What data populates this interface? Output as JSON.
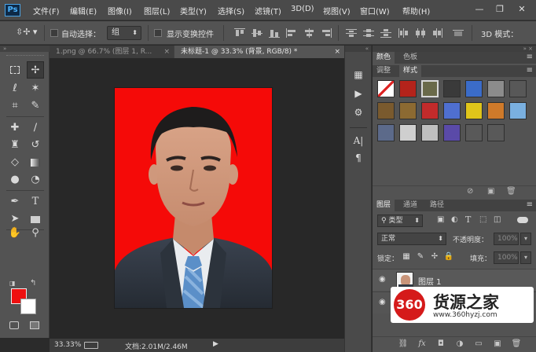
{
  "app": {
    "logo_text": "Ps"
  },
  "menu": [
    "文件(F)",
    "编辑(E)",
    "图像(I)",
    "图层(L)",
    "类型(Y)",
    "选择(S)",
    "滤镜(T)",
    "3D(D)",
    "视图(V)",
    "窗口(W)",
    "帮助(H)"
  ],
  "window_controls": {
    "minimize": "—",
    "restore": "❐",
    "close": "✕"
  },
  "options": {
    "auto_select_label": "自动选择：",
    "auto_select_value": "组",
    "show_transform_label": "显示变换控件",
    "mode_3d_label": "3D 模式："
  },
  "tabs": [
    {
      "label": "1.png @ 66.7% (图层 1, R...",
      "close": "×"
    },
    {
      "label": "未标题-1 @ 33.3% (背景, RGB/8) *",
      "close": "×"
    }
  ],
  "status": {
    "zoom": "33.33%",
    "doc_info": "文档:2.01M/2.46M"
  },
  "panels": {
    "top_tabs": [
      "颜色",
      "色板"
    ],
    "mid_tabs": [
      "调整",
      "样式"
    ],
    "layer_tabs": [
      "图层",
      "通道",
      "路径"
    ],
    "kind_filter": "类型",
    "blend_mode": "正常",
    "opacity_label": "不透明度：",
    "opacity_value": "100%",
    "lock_label": "锁定：",
    "fill_label": "填充：",
    "fill_value": "100%",
    "layer_name": "图层 1",
    "menu_glyph": "≡"
  },
  "styles": [
    {
      "name": "none-style",
      "color": "#ffffff"
    },
    {
      "name": "red-glow-style",
      "color": "#b4231b"
    },
    {
      "name": "frame-style",
      "color": "#6a6a4a"
    },
    {
      "name": "dark-bevel-style",
      "color": "#3a3a3a"
    },
    {
      "name": "blue-glass-style",
      "color": "#3b6cc9"
    },
    {
      "name": "gray-style",
      "color": "#8c8c8c"
    },
    {
      "name": "dark-gray-style",
      "color": "#585858"
    },
    {
      "name": "brown-style",
      "color": "#7a5a2e"
    },
    {
      "name": "bronze-style",
      "color": "#8c6a32"
    },
    {
      "name": "red-button-style",
      "color": "#c22b2b"
    },
    {
      "name": "rainbow-style",
      "color": "#4f6fd0"
    },
    {
      "name": "yellow-style",
      "color": "#e0c51a"
    },
    {
      "name": "orange-style",
      "color": "#cf7a2a"
    },
    {
      "name": "sky-style",
      "color": "#7ab0e0"
    },
    {
      "name": "sunset-style",
      "color": "#5c6a8a"
    },
    {
      "name": "sparkle-style",
      "color": "#cfcfcf"
    },
    {
      "name": "silver-style",
      "color": "#bfbfbf"
    },
    {
      "name": "purple-style",
      "color": "#5a4aa8"
    },
    {
      "name": "empty-style-1",
      "color": "#595959"
    },
    {
      "name": "empty-style-2",
      "color": "#595959"
    }
  ],
  "colors": {
    "foreground": "#ee1010",
    "background": "#ffffff",
    "canvas_bg": "#f50a08",
    "ui_dark": "#535353"
  },
  "watermark": {
    "badge": "360",
    "title": "货源之家",
    "url": "www.360hyzj.com"
  }
}
